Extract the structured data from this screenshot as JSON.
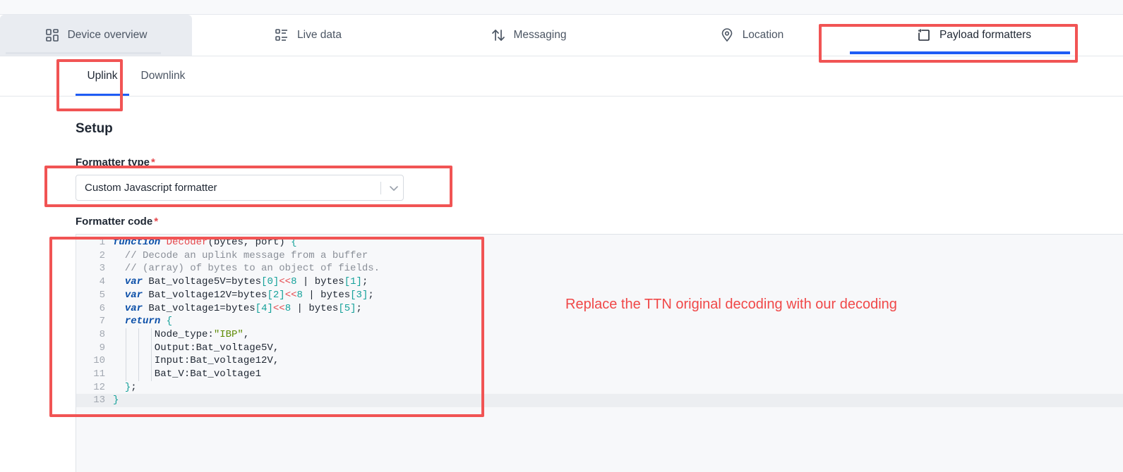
{
  "tabs": [
    {
      "label": "Device overview",
      "icon": "grid-icon"
    },
    {
      "label": "Live data",
      "icon": "list-icon"
    },
    {
      "label": "Messaging",
      "icon": "arrows-updown-icon"
    },
    {
      "label": "Location",
      "icon": "map-pin-icon"
    },
    {
      "label": "Payload formatters",
      "icon": "formatter-icon",
      "active": true
    }
  ],
  "subtabs": [
    {
      "label": "Uplink",
      "active": true
    },
    {
      "label": "Downlink"
    }
  ],
  "setup": {
    "title": "Setup",
    "formatter_type_label": "Formatter type",
    "required_mark": "*",
    "formatter_type_value": "Custom Javascript formatter",
    "formatter_code_label": "Formatter code"
  },
  "code": {
    "line_numbers": [
      "1",
      "2",
      "3",
      "4",
      "5",
      "6",
      "7",
      "8",
      "9",
      "10",
      "11",
      "12",
      "13"
    ],
    "lines": [
      "function Decoder(bytes, port) {",
      "  // Decode an uplink message from a buffer",
      "  // (array) of bytes to an object of fields.",
      "  var Bat_voltage5V=bytes[0]<<8 | bytes[1];",
      "  var Bat_voltage12V=bytes[2]<<8 | bytes[3];",
      "  var Bat_voltage1=bytes[4]<<8 | bytes[5];",
      "  return {",
      "       Node_type:\"IBP\",",
      "       Output:Bat_voltage5V,",
      "       Input:Bat_voltage12V,",
      "       Bat_V:Bat_voltage1",
      "  };",
      "}"
    ]
  },
  "annotation": "Replace the TTN original decoding with our decoding",
  "colors": {
    "highlight_box": "#f15454",
    "active_tab_underline": "#1f5cf5",
    "annotation_text": "#f04848"
  }
}
